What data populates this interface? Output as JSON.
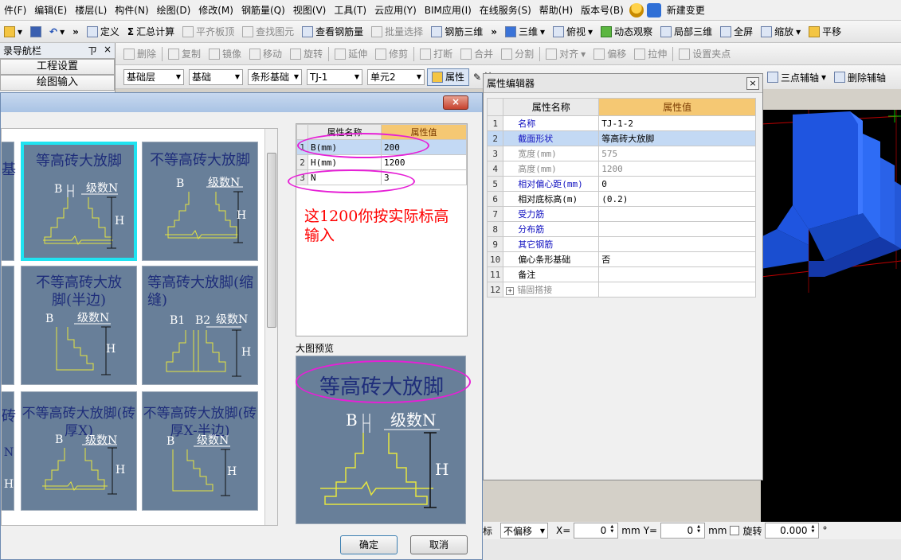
{
  "menubar": {
    "items": [
      "件(F)",
      "编辑(E)",
      "楼层(L)",
      "构件(N)",
      "绘图(D)",
      "修改(M)",
      "钢筋量(Q)",
      "视图(V)",
      "工具(T)",
      "云应用(Y)",
      "BIM应用(I)",
      "在线服务(S)",
      "帮助(H)",
      "版本号(B)"
    ],
    "new_change": "新建变更"
  },
  "toolbar1": {
    "items": [
      "定义",
      "汇总计算",
      "平齐板顶",
      "查找图元",
      "查看钢筋量",
      "批量选择",
      "钢筋三维"
    ],
    "right_items": [
      "三维",
      "俯视",
      "动态观察",
      "局部三维",
      "全屏",
      "缩放",
      "平移"
    ]
  },
  "toolbar2": {
    "items": [
      "删除",
      "复制",
      "镜像",
      "移动",
      "旋转",
      "延伸",
      "修剪",
      "打断",
      "合并",
      "分割",
      "对齐",
      "偏移",
      "拉伸",
      "设置夹点"
    ]
  },
  "toolbar3": {
    "floor": "基础层",
    "category": "基础",
    "type": "条形基础",
    "component": "TJ-1",
    "unit": "单元2",
    "property_btn": "属性",
    "edit_btn": "编",
    "right_items": [
      "三点辅轴",
      "删除辅轴"
    ]
  },
  "navigator": {
    "title": "录导航栏",
    "pin": "ㄗ",
    "close": "×",
    "items": [
      "工程设置",
      "绘图输入"
    ]
  },
  "dialog": {
    "close": "×",
    "thumbnails": [
      {
        "label": "等高砖大放脚",
        "b": "B",
        "n": "级数N",
        "h": "H"
      },
      {
        "label": "不等高砖大放脚",
        "b": "B",
        "n": "级数N",
        "h": "H"
      },
      {
        "label": "不等高砖大放脚(半边)",
        "b": "B",
        "n": "级数N",
        "h": "H"
      },
      {
        "label": "等高砖大放脚(缩缝)",
        "b": "B1",
        "b2": "B2",
        "n": "级数N",
        "h": "H"
      },
      {
        "label": "不等高砖大放脚(砖厚X)",
        "b": "B",
        "n": "级数N",
        "h": "H"
      },
      {
        "label": "不等高砖大放脚(砖厚X-半边)",
        "b": "B",
        "n": "级数N",
        "h": "H"
      }
    ],
    "edge_fragments": [
      "基",
      "级",
      "N",
      "H",
      "砖",
      "N",
      "H"
    ],
    "param_table": {
      "headers": [
        "属性名称",
        "属性值"
      ],
      "rows": [
        {
          "num": "1",
          "name": "B(mm)",
          "value": "200"
        },
        {
          "num": "2",
          "name": "H(mm)",
          "value": "1200"
        },
        {
          "num": "3",
          "name": "N",
          "value": "3"
        }
      ]
    },
    "annotation": "这1200你按实际标高输入",
    "preview_label": "大图预览",
    "preview": {
      "label": "等高砖大放脚",
      "b": "B",
      "n": "级数N",
      "h": "H"
    },
    "ok": "确定",
    "cancel": "取消"
  },
  "property_editor": {
    "title": "属性编辑器",
    "close": "×",
    "headers": [
      "属性名称",
      "属性值"
    ],
    "rows": [
      {
        "num": "1",
        "name": "名称",
        "value": "TJ-1-2",
        "style": "blue"
      },
      {
        "num": "2",
        "name": "截面形状",
        "value": "等高砖大放脚",
        "style": "blue"
      },
      {
        "num": "3",
        "name": "宽度(mm)",
        "value": "575",
        "style": "grey"
      },
      {
        "num": "4",
        "name": "高度(mm)",
        "value": "1200",
        "style": "grey"
      },
      {
        "num": "5",
        "name": "相对偏心距(mm)",
        "value": "0",
        "style": "blue"
      },
      {
        "num": "6",
        "name": "相对底标高(m)",
        "value": "(0.2)",
        "style": "normal"
      },
      {
        "num": "7",
        "name": "受力筋",
        "value": "",
        "style": "blue"
      },
      {
        "num": "8",
        "name": "分布筋",
        "value": "",
        "style": "blue"
      },
      {
        "num": "9",
        "name": "其它钢筋",
        "value": "",
        "style": "blue"
      },
      {
        "num": "10",
        "name": "偏心条形基础",
        "value": "否",
        "style": "normal"
      },
      {
        "num": "11",
        "name": "备注",
        "value": "",
        "style": "normal"
      },
      {
        "num": "12",
        "name": "锚固搭接",
        "value": "",
        "style": "grey"
      }
    ],
    "expand": "+"
  },
  "statusbar": {
    "label": "标",
    "offset": "不偏移",
    "x_label": "X=",
    "x_value": "0",
    "mm1": "mm",
    "y_label": "Y=",
    "y_value": "0",
    "mm2": "mm",
    "rotate_label": "旋转",
    "rotate_value": "0.000",
    "degree": "°"
  },
  "colors": {
    "thumb_bg": "#687f99",
    "selected_border": "#1fe3f1",
    "highlight_ellipse": "#e620d6",
    "annotation": "#ff0000",
    "header_orange": "#f5c873",
    "footing_blue": "#1f55e0"
  }
}
